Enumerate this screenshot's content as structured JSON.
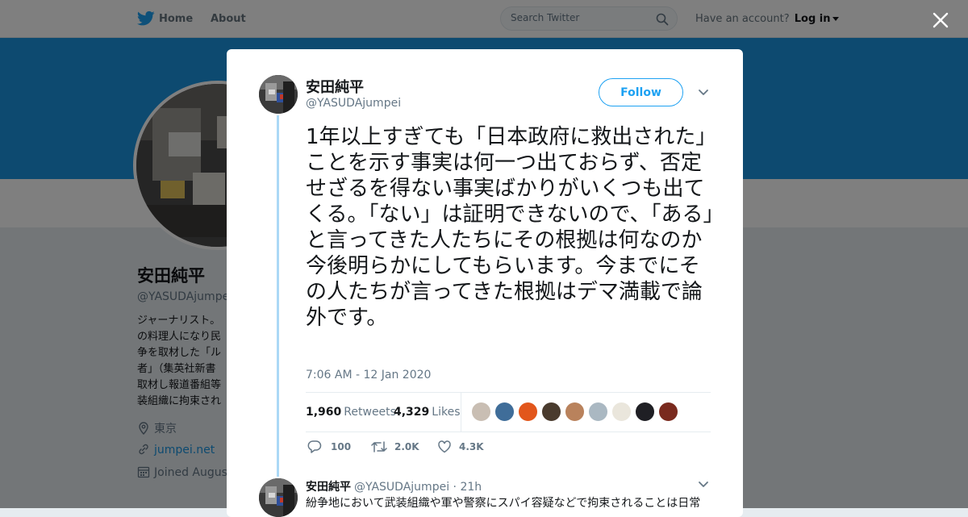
{
  "nav": {
    "home": "Home",
    "about": "About",
    "search_placeholder": "Search Twitter",
    "have_account": "Have an account?",
    "login": "Log in"
  },
  "profile": {
    "name": "安田純平",
    "handle": "@YASUDAjumpei",
    "bio": "ジャーナリスト。\nの料理人になり民\n争を取材した「ル\n者」（集英社新書\n取材し報道番組等\n装組織に拘束され",
    "location": "東京",
    "website": "jumpei.net",
    "joined": "Joined August"
  },
  "tweet": {
    "name": "安田純平",
    "handle": "@YASUDAjumpei",
    "follow_label": "Follow",
    "text": "1年以上すぎても「日本政府に救出された」ことを示す事実は何一つ出ておらず、否定せざるを得ない事実ばかりがいくつも出てくる。「ない」は証明できないので、「ある」と言ってきた人たちにその根拠は何なのか今後明らかにしてもらいます。今までにその人たちが言ってきた根拠はデマ満載で論外です。",
    "time": "7:06 AM - 12 Jan 2020",
    "retweets_count": "1,960",
    "retweets_label": "Retweets",
    "likes_count": "4,329",
    "likes_label": "Likes",
    "reply_count": "100",
    "retweet_count_short": "2.0K",
    "like_count_short": "4.3K"
  },
  "likers": [
    {
      "icon": "liker-avatar",
      "color": "#c9beb3"
    },
    {
      "icon": "liker-avatar",
      "color": "#3f6d99"
    },
    {
      "icon": "liker-avatar",
      "color": "#e2561b"
    },
    {
      "icon": "liker-avatar",
      "color": "#4a3b2e"
    },
    {
      "icon": "liker-avatar",
      "color": "#b9825c"
    },
    {
      "icon": "liker-avatar",
      "color": "#aab8c2"
    },
    {
      "icon": "liker-avatar",
      "color": "#eae6dc"
    },
    {
      "icon": "liker-avatar",
      "color": "#1f1f24"
    },
    {
      "icon": "liker-avatar",
      "color": "#7a2a1e"
    }
  ],
  "reply": {
    "name": "安田純平",
    "handle": "@YASUDAjumpei",
    "sep": "·",
    "time": "21h",
    "text": "紛争地において武装組織や軍や警察にスパイ容疑などで拘束されることは日常"
  },
  "colors": {
    "brand": "#1da1f2",
    "banner": "#1b95e0",
    "thread_line": "#abd8f6"
  }
}
